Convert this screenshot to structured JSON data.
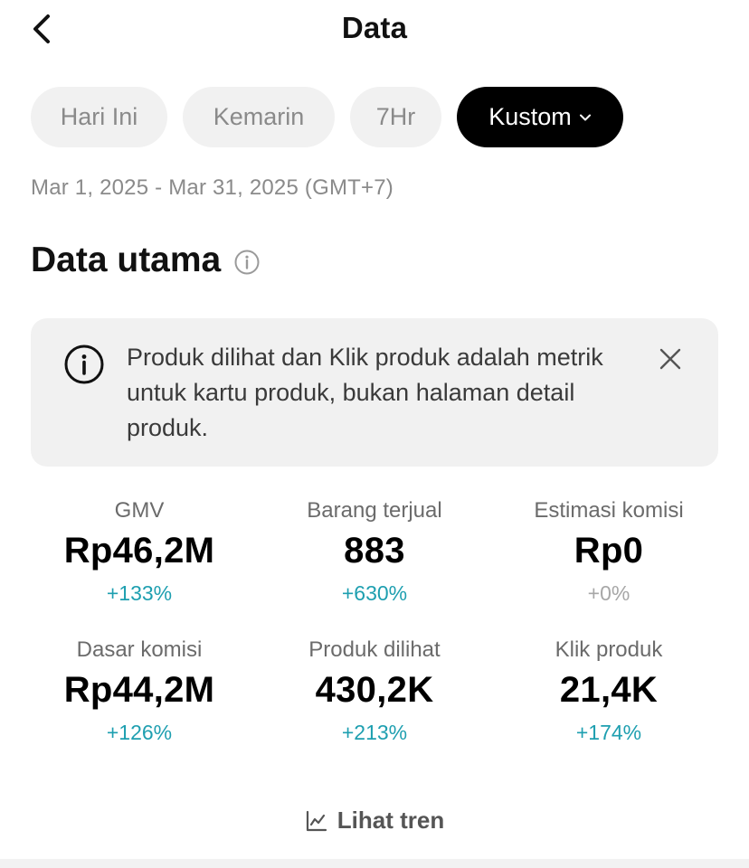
{
  "header": {
    "title": "Data",
    "back_icon": "chevron-left-icon"
  },
  "filters": {
    "chips": [
      {
        "label": "Hari Ini",
        "active": false
      },
      {
        "label": "Kemarin",
        "active": false
      },
      {
        "label": "7Hr",
        "active": false
      },
      {
        "label": "Kustom",
        "active": true
      }
    ],
    "date_range": "Mar 1, 2025 - Mar 31, 2025 (GMT+7)"
  },
  "section": {
    "title": "Data utama",
    "info_icon": "info-icon"
  },
  "notice": {
    "text": "Produk dilihat dan Klik produk adalah metrik untuk kartu produk, bukan halaman detail produk.",
    "icon": "info-icon",
    "close_icon": "close-icon"
  },
  "metrics": [
    {
      "label": "GMV",
      "value": "Rp46,2M",
      "change": "+133%"
    },
    {
      "label": "Barang terjual",
      "value": "883",
      "change": "+630%"
    },
    {
      "label": "Estimasi komisi",
      "value": "Rp0",
      "change": "+0%"
    },
    {
      "label": "Dasar komisi",
      "value": "Rp44,2M",
      "change": "+126%"
    },
    {
      "label": "Produk dilihat",
      "value": "430,2K",
      "change": "+213%"
    },
    {
      "label": "Klik produk",
      "value": "21,4K",
      "change": "+174%"
    }
  ],
  "trend_link": {
    "label": "Lihat tren",
    "icon": "line-chart-icon"
  },
  "colors": {
    "accent_change": "#1e9fb0",
    "neutral_change": "#a7a7a7",
    "active_chip_bg": "#000000",
    "chip_bg": "#f1f1f1"
  }
}
